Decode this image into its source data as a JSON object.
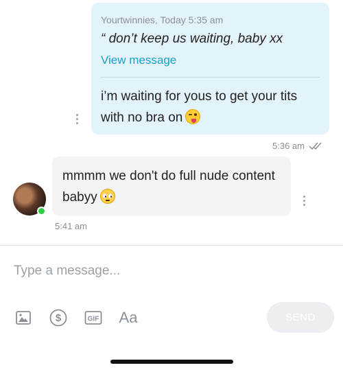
{
  "conversation": {
    "sent_message": {
      "quote_sender": "Yourtwinnies",
      "quote_time": "Today 5:35 am",
      "quote_meta": "Yourtwinnies, Today 5:35 am",
      "quote_text": "“ don’t keep us waiting, baby xx",
      "view_link": "View message",
      "text": "i’m waiting for yous to get your tits with no bra on",
      "emoji": "winking-tongue-emoji",
      "time": "5:36 am",
      "status": "read"
    },
    "received_message": {
      "text": "mmmm we don't do full nude content babyy",
      "emoji": "pleading-face-emoji",
      "time": "5:41 am",
      "sender_online": true
    }
  },
  "composer": {
    "placeholder": "Type a message...",
    "format_label": "Aa",
    "send_label": "SEND",
    "icons": [
      "image-icon",
      "dollar-icon",
      "gif-icon",
      "text-format-icon"
    ]
  },
  "colors": {
    "sent_bubble": "#e3f3fb",
    "received_bubble": "#f2f3f5",
    "link": "#17a2c8",
    "online": "#2ecc40",
    "muted": "#8a8f96"
  }
}
